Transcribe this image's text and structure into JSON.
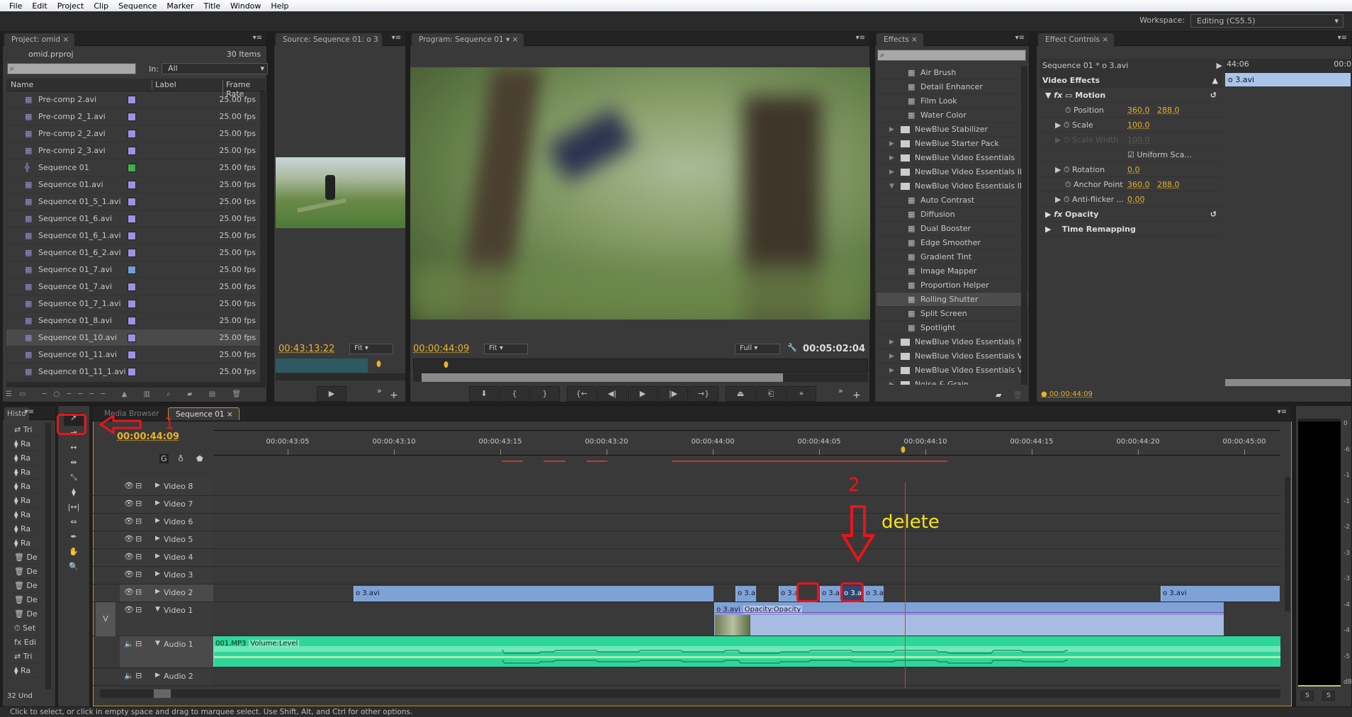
{
  "menu": [
    "File",
    "Edit",
    "Project",
    "Clip",
    "Sequence",
    "Marker",
    "Title",
    "Window",
    "Help"
  ],
  "workspace": {
    "label": "Workspace:",
    "value": "Editing (CS5.5)"
  },
  "project": {
    "tab": "Project: omid",
    "file": "omid.prproj",
    "count": "30 Items",
    "in_label": "In:",
    "in_value": "All",
    "columns": [
      "Name",
      "Label",
      "Frame Rate"
    ],
    "items": [
      {
        "name": "Pre-comp 2.avi",
        "label": "#a38fe6",
        "fps": "25.00 fps",
        "icon": "film-icon"
      },
      {
        "name": "Pre-comp 2_1.avi",
        "label": "#a38fe6",
        "fps": "25.00 fps",
        "icon": "film-icon"
      },
      {
        "name": "Pre-comp 2_2.avi",
        "label": "#a38fe6",
        "fps": "25.00 fps",
        "icon": "film-icon"
      },
      {
        "name": "Pre-comp 2_3.avi",
        "label": "#a38fe6",
        "fps": "25.00 fps",
        "icon": "film-icon"
      },
      {
        "name": "Sequence 01",
        "label": "#3fb04c",
        "fps": "25.00 fps",
        "icon": "sequence-icon"
      },
      {
        "name": "Sequence 01.avi",
        "label": "#a38fe6",
        "fps": "25.00 fps",
        "icon": "film-icon"
      },
      {
        "name": "Sequence 01_5_1.avi",
        "label": "#a38fe6",
        "fps": "25.00 fps",
        "icon": "film-icon"
      },
      {
        "name": "Sequence 01_6.avi",
        "label": "#a38fe6",
        "fps": "25.00 fps",
        "icon": "film-icon"
      },
      {
        "name": "Sequence 01_6_1.avi",
        "label": "#a38fe6",
        "fps": "25.00 fps",
        "icon": "film-icon"
      },
      {
        "name": "Sequence 01_6_2.avi",
        "label": "#a38fe6",
        "fps": "25.00 fps",
        "icon": "film-icon"
      },
      {
        "name": "Sequence 01_7.avi",
        "label": "#6f9fd8",
        "fps": "25.00 fps",
        "icon": "av-clip-icon"
      },
      {
        "name": "Sequence 01_7.avi",
        "label": "#a38fe6",
        "fps": "25.00 fps",
        "icon": "film-icon"
      },
      {
        "name": "Sequence 01_7_1.avi",
        "label": "#a38fe6",
        "fps": "25.00 fps",
        "icon": "film-icon"
      },
      {
        "name": "Sequence 01_8.avi",
        "label": "#a38fe6",
        "fps": "25.00 fps",
        "icon": "film-icon"
      },
      {
        "name": "Sequence 01_10.avi",
        "label": "#a38fe6",
        "fps": "25.00 fps",
        "icon": "film-icon",
        "selected": true
      },
      {
        "name": "Sequence 01_11.avi",
        "label": "#a38fe6",
        "fps": "25.00 fps",
        "icon": "film-icon"
      },
      {
        "name": "Sequence 01_11_1.avi",
        "label": "#a38fe6",
        "fps": "25.00 fps",
        "icon": "film-icon"
      }
    ]
  },
  "source": {
    "tab": "Source: Sequence 01: o 3",
    "timecode": "00:43:13:22",
    "fit": "Fit"
  },
  "program": {
    "tab": "Program: Sequence 01",
    "timecode": "00:00:44:09",
    "fit": "Fit",
    "quality": "Full",
    "duration": "00:05:02:04"
  },
  "effects": {
    "tab": "Effects",
    "items": [
      {
        "label": "Air Brush",
        "type": "effect"
      },
      {
        "label": "Detail Enhancer",
        "type": "effect"
      },
      {
        "label": "Film Look",
        "type": "effect"
      },
      {
        "label": "Water Color",
        "type": "effect"
      },
      {
        "label": "NewBlue Stabilizer",
        "type": "folder"
      },
      {
        "label": "NewBlue Starter Pack",
        "type": "folder"
      },
      {
        "label": "NewBlue Video Essentials",
        "type": "folder"
      },
      {
        "label": "NewBlue Video Essentials II",
        "type": "folder"
      },
      {
        "label": "NewBlue Video Essentials III",
        "type": "folder",
        "open": true
      },
      {
        "label": "Auto Contrast",
        "type": "effect"
      },
      {
        "label": "Diffusion",
        "type": "effect"
      },
      {
        "label": "Dual Booster",
        "type": "effect"
      },
      {
        "label": "Edge Smoother",
        "type": "effect"
      },
      {
        "label": "Gradient Tint",
        "type": "effect"
      },
      {
        "label": "Image Mapper",
        "type": "effect"
      },
      {
        "label": "Proportion Helper",
        "type": "effect"
      },
      {
        "label": "Rolling Shutter",
        "type": "effect",
        "selected": true
      },
      {
        "label": "Split Screen",
        "type": "effect"
      },
      {
        "label": "Spotlight",
        "type": "effect"
      },
      {
        "label": "NewBlue Video Essentials IV",
        "type": "folder"
      },
      {
        "label": "NewBlue Video Essentials V",
        "type": "folder"
      },
      {
        "label": "NewBlue Video Essentials VII",
        "type": "folder"
      },
      {
        "label": "Noise & Grain",
        "type": "folder"
      }
    ]
  },
  "effect_controls": {
    "tab": "Effect Controls",
    "clip": "Sequence 01 * o 3.avi",
    "time_start": "44:06",
    "time_end": "00:0",
    "clip_bar": "o 3.avi",
    "section": "Video Effects",
    "motion": "Motion",
    "position_label": "Position",
    "position_x": "360.0",
    "position_y": "288.0",
    "scale_label": "Scale",
    "scale": "100.0",
    "scale_width_label": "Scale Width",
    "scale_width": "100.0",
    "uniform": "Uniform Sca...",
    "rotation_label": "Rotation",
    "rotation": "0.0",
    "anchor_label": "Anchor Point",
    "anchor_x": "360.0",
    "anchor_y": "288.0",
    "antiflicker_label": "Anti-flicker ...",
    "antiflicker": "0.00",
    "opacity": "Opacity",
    "time_remap": "Time Remapping",
    "timecode": "00:00:44:09"
  },
  "history": {
    "tab": "Histo",
    "items": [
      "Tri",
      "Ra",
      "Ra",
      "Ra",
      "Ra",
      "Ra",
      "Ra",
      "Ra",
      "Ra",
      "De",
      "De",
      "De",
      "De",
      "De",
      "Set",
      "Edi",
      "Tri",
      "Ra"
    ],
    "undos": "32 Und"
  },
  "timeline": {
    "tabs": [
      "Media Browser",
      "Sequence 01"
    ],
    "timecode": "00:00:44:09",
    "ruler": [
      "00:00:43:05",
      "00:00:43:10",
      "00:00:43:15",
      "00:00:43:20",
      "00:00:44:00",
      "00:00:44:05",
      "00:00:44:10",
      "00:00:44:15",
      "00:00:44:20",
      "00:00:45:00"
    ],
    "video_tracks": [
      "Video 8",
      "Video 7",
      "Video 6",
      "Video 5",
      "Video 4",
      "Video 3",
      "Video 2",
      "Video 1"
    ],
    "audio_tracks": [
      "Audio 1",
      "Audio 2"
    ],
    "v_target": "V",
    "v2_clips": [
      "o 3.avi",
      "o 3.a",
      "o 3.a",
      "o 3.a",
      "o 3.a",
      "o 3.a",
      "o 3.avi"
    ],
    "v1_clip": "o 3.avi",
    "v1_fx": "Opacity:Opacity",
    "a1_clip": "001.MP3",
    "a1_fx": "Volume:Level"
  },
  "annotations": {
    "step1": "1",
    "step2": "2",
    "delete": "delete",
    "color": "#e8151c",
    "text_color": "#f2e51b"
  },
  "meter": {
    "scale": [
      "0",
      "-6",
      "-1",
      "-1",
      "-2",
      "-3",
      "-3",
      "-4",
      "-4",
      "-5",
      "dB"
    ],
    "solo": [
      "S",
      "S"
    ]
  },
  "status": "Click to select, or click in empty space and drag to marquee select. Use Shift, Alt, and Ctrl for other options."
}
